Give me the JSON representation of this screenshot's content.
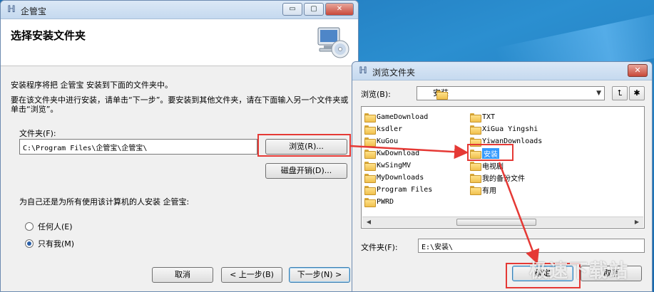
{
  "installer": {
    "title": "企管宝",
    "header_title": "选择安装文件夹",
    "intro_line1": "安装程序将把 企管宝 安装到下面的文件夹中。",
    "intro_line2": "要在该文件夹中进行安装，请单击“下一步”。要安装到其他文件夹，请在下面输入另一个文件夹或单击“浏览”。",
    "folder_label": "文件夹(F):",
    "folder_value": "C:\\Program Files\\企管宝\\企管宝\\",
    "browse_label": "浏览(R)...",
    "disk_cost_label": "磁盘开销(D)...",
    "who_label": "为自己还是为所有使用该计算机的人安装 企管宝:",
    "radio_anyone": "任何人(E)",
    "radio_me": "只有我(M)",
    "selected_radio": "me",
    "cancel_label": "取消",
    "prev_label": "< 上一步(B)",
    "next_label": "下一步(N) >",
    "controls": {
      "minimize": "▭",
      "maximize": "▢",
      "close": "✕"
    }
  },
  "browse_dialog": {
    "title": "浏览文件夹",
    "look_in_label": "浏览(B):",
    "look_in_value": "安装",
    "folders_col1": [
      "GameDownload",
      "ksdler",
      "KuGou",
      "KwDownload",
      "KwSingMV",
      "MyDownloads",
      "Program Files",
      "PWRD"
    ],
    "folders_col2": [
      "TXT",
      "XiGua Yingshi",
      "YiwanDownloads",
      "安装",
      "电视剧",
      "我的备份文件",
      "有用"
    ],
    "selected_folder": "安装",
    "folder_label": "文件夹(F):",
    "folder_value": "E:\\安装\\",
    "ok_label": "确定",
    "cancel_label": "取消",
    "close_glyph": "✕"
  },
  "watermark": "极速下载站",
  "colors": {
    "annotation": "#e53935",
    "selection": "#3399ff"
  }
}
